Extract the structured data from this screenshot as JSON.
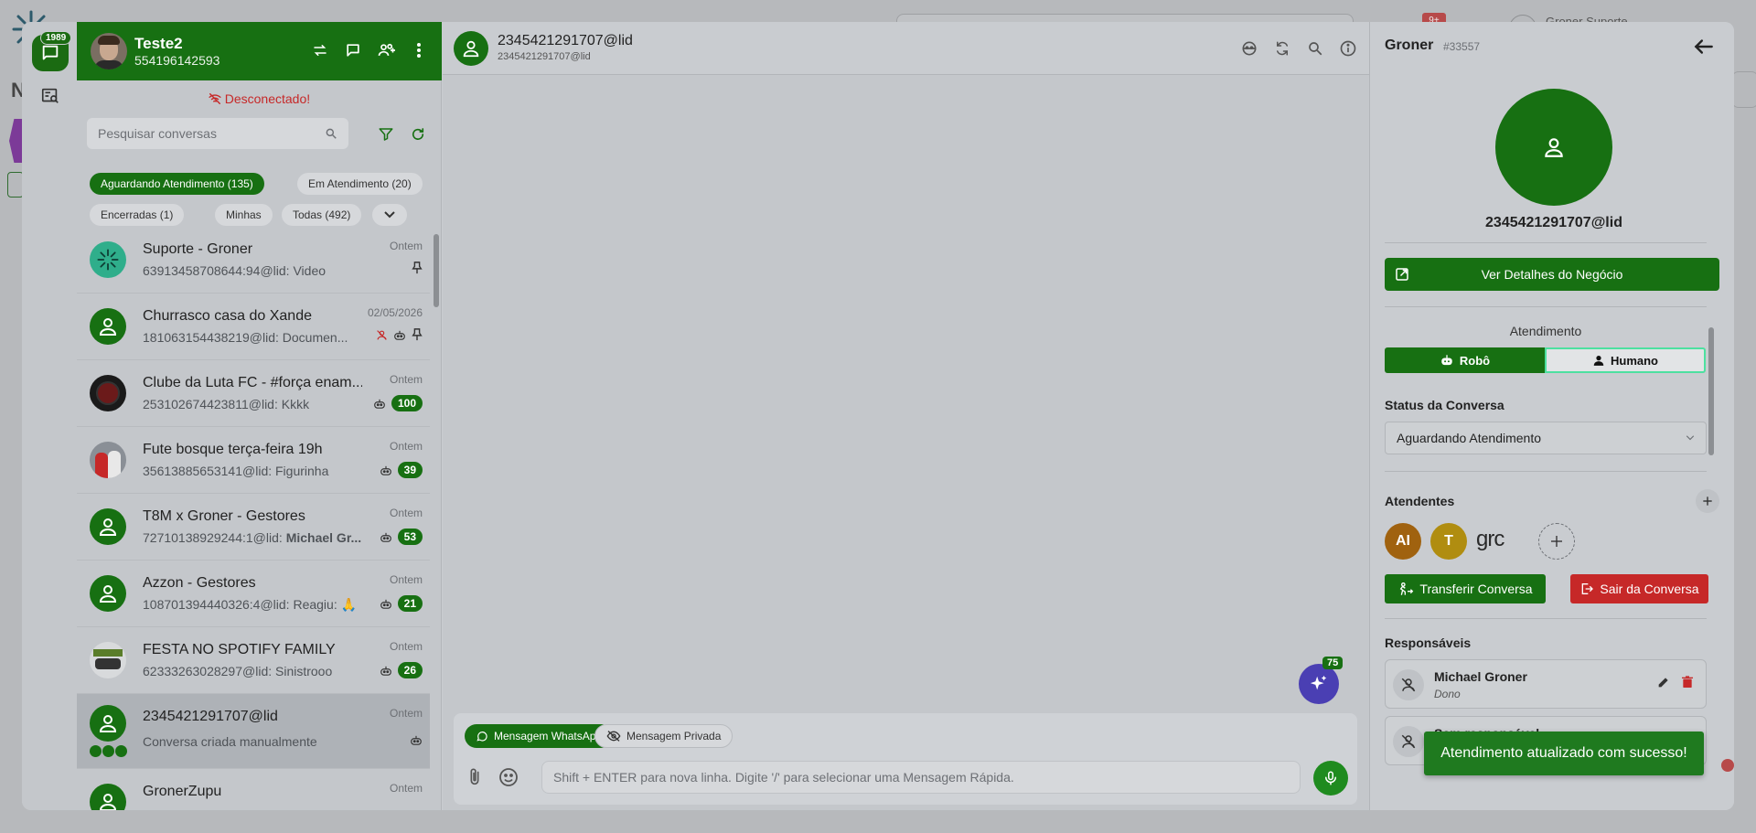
{
  "background": {
    "badge": "9+",
    "user_name": "Groner Suporte",
    "page_letter": "N"
  },
  "rail": {
    "chat_badge": "1989"
  },
  "list_header": {
    "name": "Teste2",
    "phone": "554196142593"
  },
  "status": {
    "disconnected": "Desconectado!"
  },
  "search": {
    "placeholder": "Pesquisar conversas"
  },
  "filters": [
    {
      "label": "Aguardando Atendimento (135)",
      "active": true
    },
    {
      "label": "Em Atendimento (20)",
      "active": false
    },
    {
      "label": "Encerradas (1)",
      "active": false
    },
    {
      "label": "Minhas",
      "active": false
    },
    {
      "label": "Todas (492)",
      "active": false
    }
  ],
  "conversations": [
    {
      "title": "Suporte - Groner",
      "subtitle": "63913458708644:94@lid: Video",
      "time": "Ontem",
      "count": "",
      "avatar": "logo"
    },
    {
      "title": "Churrasco casa do Xande",
      "subtitle": "181063154438219@lid: Documen...",
      "time": "02/05/2026",
      "count": "",
      "avatar": "user"
    },
    {
      "title": "Clube da Luta FC - #força enam...",
      "subtitle": "253102674423811@lid: Kkkk",
      "time": "Ontem",
      "count": "100",
      "avatar": "dark"
    },
    {
      "title": "Fute bosque terça-feira 19h",
      "subtitle": "35613885653141@lid: Figurinha",
      "time": "Ontem",
      "count": "39",
      "avatar": "photo"
    },
    {
      "title": "T8M x Groner - Gestores",
      "subtitle_prefix": "72710138929244:1@lid: ",
      "subtitle_bold": "Michael Gr...",
      "time": "Ontem",
      "count": "53",
      "avatar": "user"
    },
    {
      "title": "Azzon - Gestores",
      "subtitle": "108701394440326:4@lid: Reagiu: 🙏",
      "time": "Ontem",
      "count": "21",
      "avatar": "user"
    },
    {
      "title": "FESTA NO SPOTIFY FAMILY",
      "subtitle": "62333263028297@lid: Sinistrooo",
      "time": "Ontem",
      "count": "26",
      "avatar": "photo2"
    },
    {
      "title": "2345421291707@lid",
      "subtitle": "Conversa criada manualmente",
      "time": "Ontem",
      "count": "",
      "avatar": "user",
      "selected": true
    },
    {
      "title": "GronerZupu",
      "subtitle": "",
      "time": "Ontem",
      "count": "",
      "avatar": "user"
    }
  ],
  "chat": {
    "title": "2345421291707@lid",
    "subtitle": "2345421291707@lid",
    "ai_badge": "75",
    "tab_whatsapp": "Mensagem WhatsApp",
    "tab_private": "Mensagem Privada",
    "input_placeholder": "Shift + ENTER para nova linha. Digite '/' para selecionar uma Mensagem Rápida."
  },
  "details": {
    "title": "Groner",
    "id": "#33557",
    "lid": "2345421291707@lid",
    "business_button": "Ver Detalhes do Negócio",
    "atendimento_label": "Atendimento",
    "toggle_robo": "Robô",
    "toggle_humano": "Humano",
    "status_label": "Status da Conversa",
    "status_value": "Aguardando Atendimento",
    "atendentes_label": "Atendentes",
    "agents": [
      {
        "initials": "AI",
        "color": "#a0620f"
      },
      {
        "initials": "T",
        "color": "#b08d10"
      }
    ],
    "agent_text": "grc",
    "transfer_button": "Transferir Conversa",
    "leave_button": "Sair da Conversa",
    "responsaveis_label": "Responsáveis",
    "responsible": {
      "name": "Michael Groner",
      "role": "Dono"
    },
    "responsible2": {
      "name": "Sem responsável",
      "role": ""
    }
  },
  "toast": {
    "message": "Atendimento atualizado com sucesso!"
  },
  "colors": {
    "primary": "#177012",
    "danger": "#c62828",
    "ai": "#4a3fb3"
  }
}
